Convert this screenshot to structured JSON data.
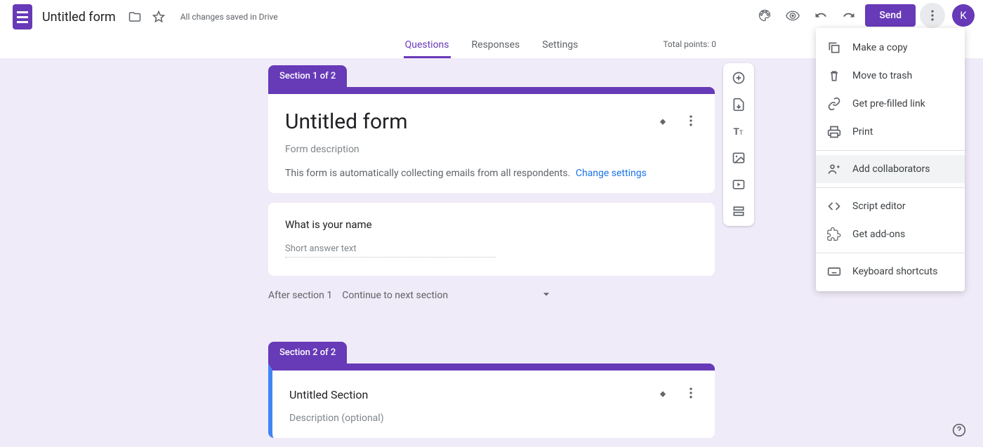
{
  "header": {
    "title": "Untitled form",
    "save_status": "All changes saved in Drive",
    "send_label": "Send",
    "avatar_letter": "K"
  },
  "tabs": {
    "questions": "Questions",
    "responses": "Responses",
    "settings": "Settings",
    "total_points": "Total points: 0"
  },
  "section1": {
    "tab": "Section 1 of 2",
    "form_title": "Untitled form",
    "form_description": "Form description",
    "email_notice": "This form is automatically collecting emails from all respondents.",
    "change_settings": "Change settings",
    "question_text": "What is your name",
    "answer_placeholder": "Short answer text",
    "after_label": "After section 1",
    "after_value": "Continue to next section"
  },
  "section2": {
    "tab": "Section 2 of 2",
    "title": "Untitled Section",
    "description": "Description (optional)"
  },
  "menu": {
    "make_copy": "Make a copy",
    "move_trash": "Move to trash",
    "prefilled": "Get pre-filled link",
    "print": "Print",
    "collab": "Add collaborators",
    "script": "Script editor",
    "addons": "Get add-ons",
    "shortcuts": "Keyboard shortcuts"
  }
}
